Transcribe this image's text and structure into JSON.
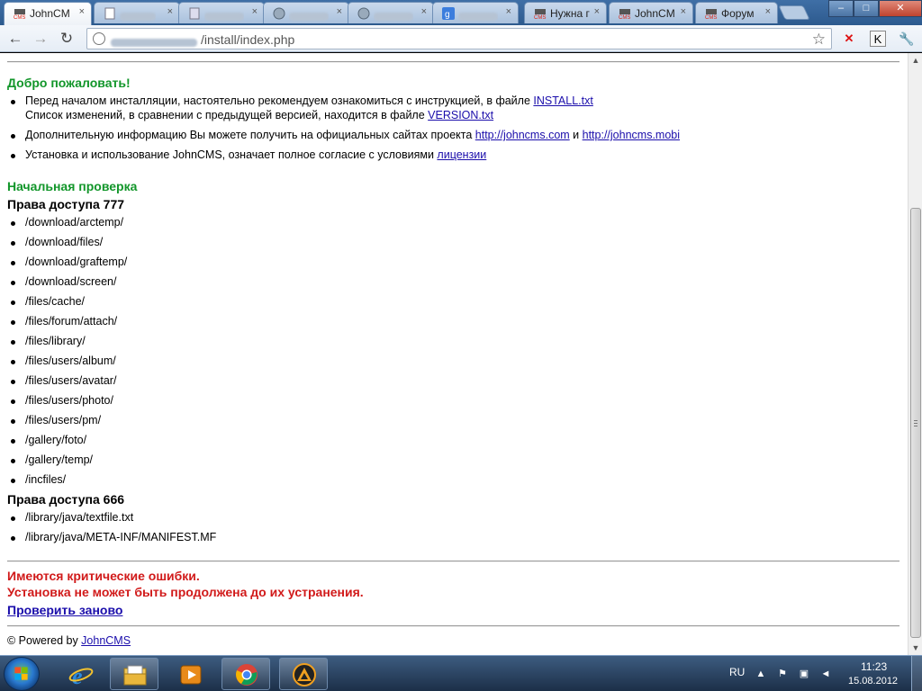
{
  "browser": {
    "tabs": [
      {
        "title": "JohnCM",
        "favicon": "johncms-icon",
        "active": true
      },
      {
        "title": "",
        "favicon": "page-icon",
        "active": false
      },
      {
        "title": "",
        "favicon": "page-icon",
        "active": false
      },
      {
        "title": "",
        "favicon": "globe-icon",
        "active": false
      },
      {
        "title": "",
        "favicon": "globe-icon",
        "active": false
      },
      {
        "title": "",
        "favicon": "google-icon",
        "active": false
      },
      {
        "title": "Нужна г",
        "favicon": "johncms-icon",
        "active": false
      },
      {
        "title": "JohnCM",
        "favicon": "johncms-icon",
        "active": false
      },
      {
        "title": "Форум",
        "favicon": "johncms-icon",
        "active": false
      }
    ],
    "close_glyph": "×",
    "window_controls": {
      "minimize": "–",
      "maximize": "□",
      "close": "✕"
    },
    "address": {
      "path": "/install/index.php"
    },
    "toolbar_icons": {
      "back": "←",
      "forward": "→",
      "reload": "↻",
      "star": "☆",
      "wrench": "🔧",
      "ext_k": "K"
    }
  },
  "page": {
    "welcome_title": "Добро пожаловать!",
    "intro": {
      "item1_text": "Перед началом инсталляции, настоятельно рекомендуем ознакомиться с инструкцией, в файле ",
      "item1_link": "INSTALL.txt",
      "item1_line2_text": "Список изменений, в сравнении с предыдущей версией, находится в файле ",
      "item1_line2_link": "VERSION.txt",
      "item2_text": "Дополнительную информацию Вы можете получить на официальных сайтах проекта ",
      "item2_link1": "http://johncms.com",
      "item2_and": " и ",
      "item2_link2": "http://johncms.mobi",
      "item3_text": "Установка и использование JohnCMS, означает полное согласие с условиями ",
      "item3_link": "лицензии"
    },
    "check_title": "Начальная проверка",
    "perm777_title": "Права доступа 777",
    "perm777_dirs": [
      "/download/arctemp/",
      "/download/files/",
      "/download/graftemp/",
      "/download/screen/",
      "/files/cache/",
      "/files/forum/attach/",
      "/files/library/",
      "/files/users/album/",
      "/files/users/avatar/",
      "/files/users/photo/",
      "/files/users/pm/",
      "/gallery/foto/",
      "/gallery/temp/",
      "/incfiles/"
    ],
    "perm666_title": "Права доступа 666",
    "perm666_files": [
      "/library/java/textfile.txt",
      "/library/java/META-INF/MANIFEST.MF"
    ],
    "error_line1": "Имеются критические ошибки.",
    "error_line2": "Установка не может быть продолжена до их устранения.",
    "retry_label": "Проверить заново",
    "powered_prefix": "© Powered by ",
    "powered_link": "JohnCMS"
  },
  "taskbar": {
    "apps": [
      "internet-explorer-icon",
      "explorer-folder-icon",
      "media-player-icon",
      "chrome-icon",
      "aimp-icon"
    ],
    "language": "RU",
    "time": "11:23",
    "date": "15.08.2012"
  }
}
